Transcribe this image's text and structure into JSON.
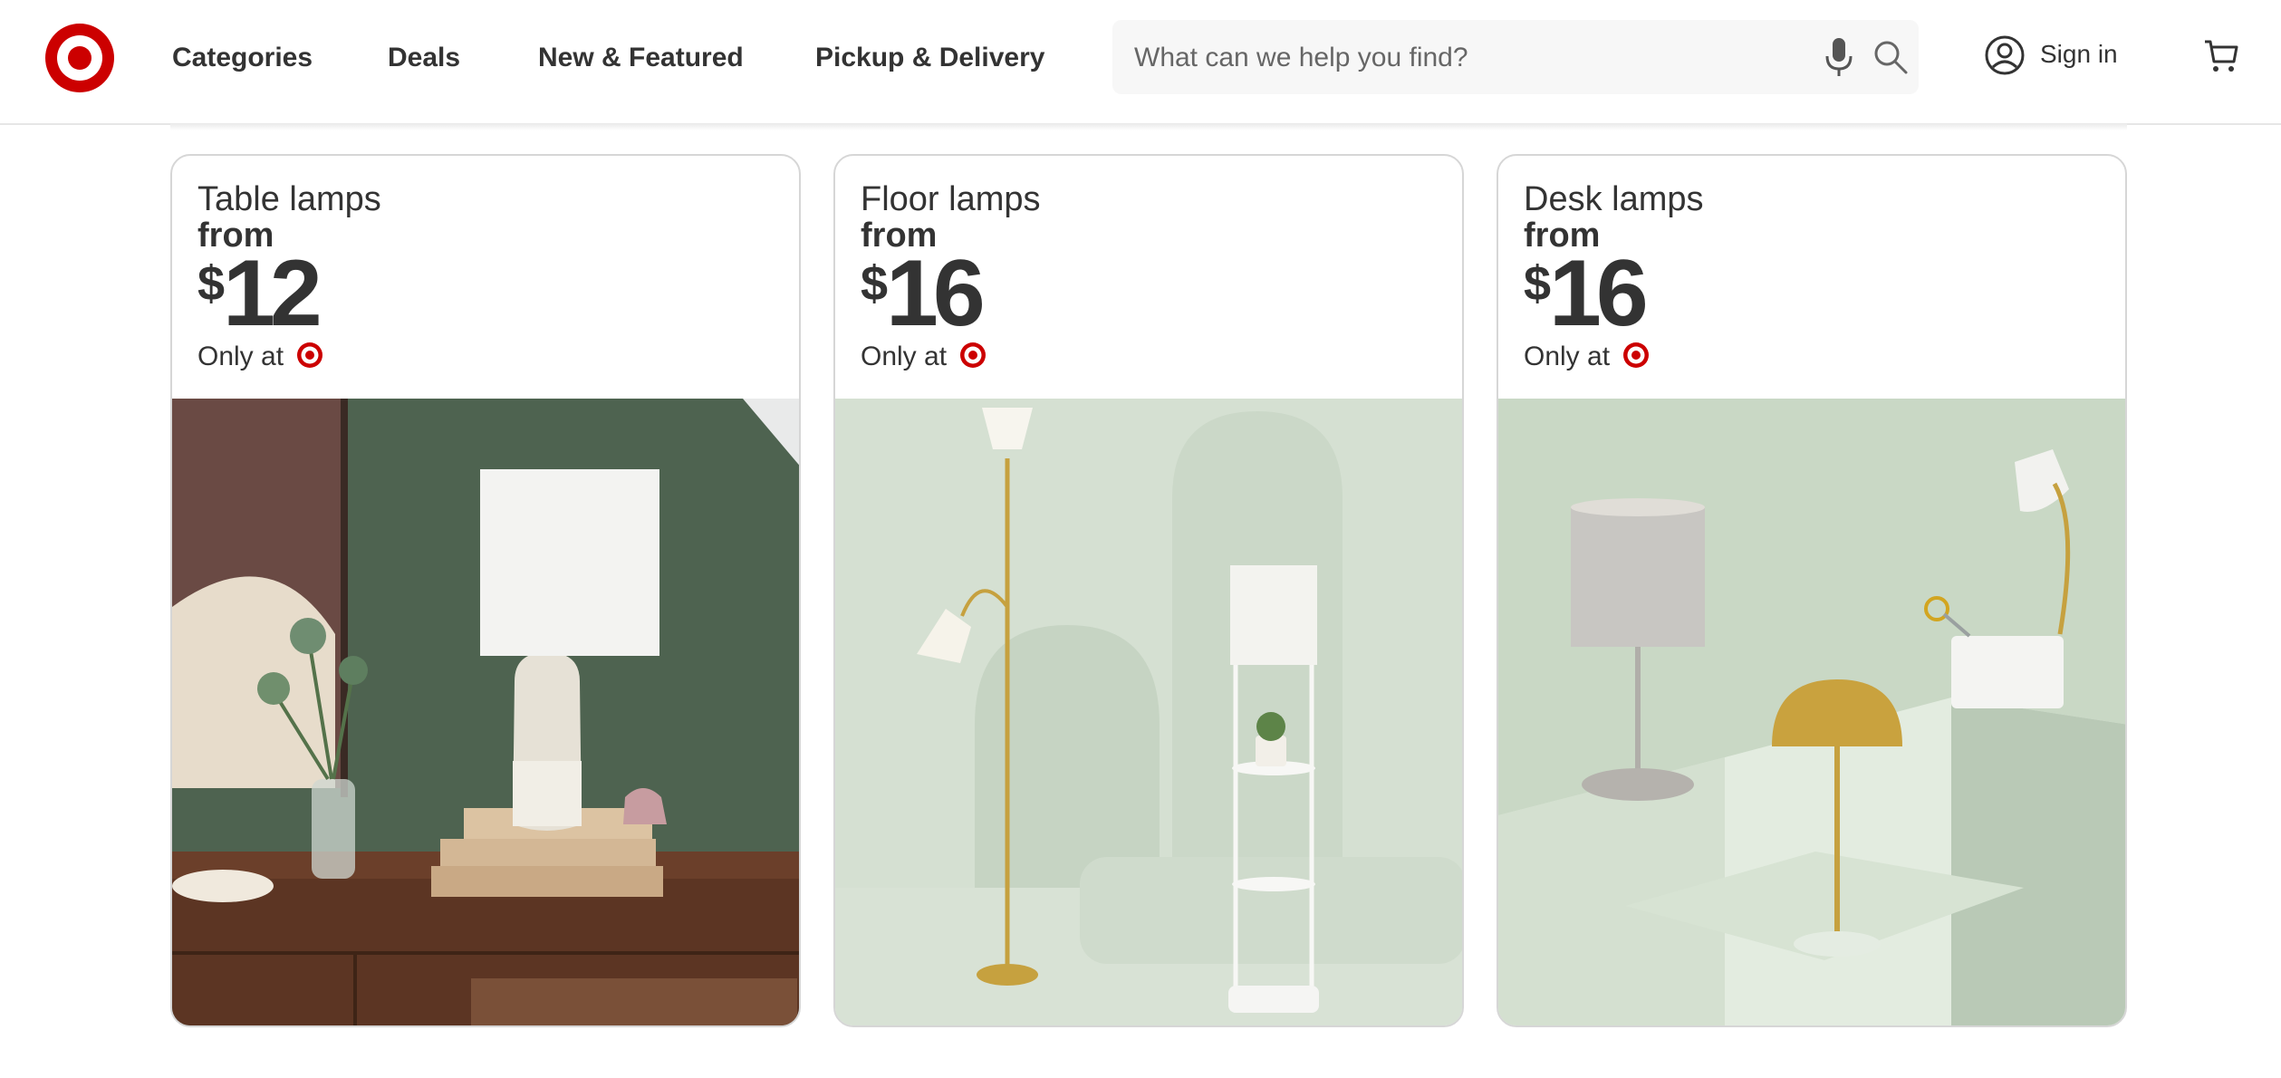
{
  "header": {
    "nav": [
      "Categories",
      "Deals",
      "New & Featured",
      "Pickup & Delivery"
    ],
    "search_placeholder": "What can we help you find?",
    "signin_label": "Sign in"
  },
  "brand_color": "#cc0000",
  "cards": [
    {
      "category": "Table lamps",
      "from": "from",
      "currency": "$",
      "price": "12",
      "only_at": "Only at"
    },
    {
      "category": "Floor lamps",
      "from": "from",
      "currency": "$",
      "price": "16",
      "only_at": "Only at"
    },
    {
      "category": "Desk lamps",
      "from": "from",
      "currency": "$",
      "price": "16",
      "only_at": "Only at"
    }
  ]
}
